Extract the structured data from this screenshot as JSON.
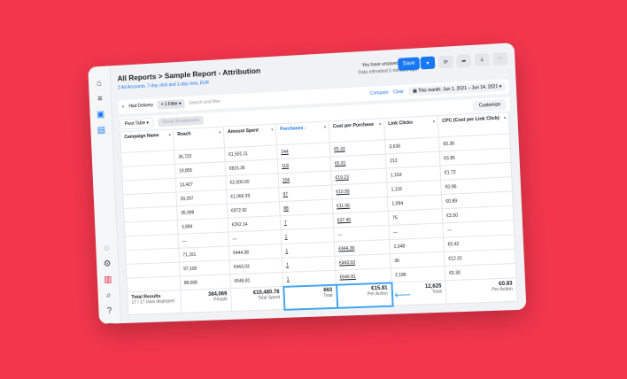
{
  "breadcrumb": {
    "root": "All Reports",
    "sep": ">",
    "current": "Sample Report - Attribution"
  },
  "subtitle": "2 Ad Accounts, 7-day click and 1-day view, EUR",
  "status": {
    "unsaved": "You have unsaved changes",
    "refreshed": "Data refreshed 5 minutes ago"
  },
  "toolbar": {
    "save": "Save",
    "save_dropdown": "▾",
    "refresh": "⟳",
    "share": "➦",
    "download": "⤓",
    "more": "···"
  },
  "filter": {
    "search_icon": "⌕",
    "delivery": "Had Delivery",
    "filter_chip": "+ 1 Filter ▾",
    "placeholder": "Search and filter",
    "compare": "Compare",
    "clear": "Clear",
    "date_icon": "▦",
    "date": "This month: Jun 1, 2021 – Jun 14, 2021 ▾"
  },
  "view": {
    "pivot": "Pivot Table ▾",
    "group": "Group Breakdowns",
    "customize": "Customize"
  },
  "sidebar": {
    "icons": [
      "⌂",
      "≡",
      "▣",
      "▤",
      "◌",
      "⚙",
      "▥",
      "⌕",
      "?",
      "▦"
    ]
  },
  "columns": [
    "Campaign Name",
    "Reach",
    "Amount Spent",
    "Purchases ↓",
    "Cost per Purchase",
    "Link Clicks",
    "CPC (Cost per Link Click)"
  ],
  "rows": [
    [
      "",
      "36,722",
      "€1,501.11",
      "244",
      "€5.33",
      "3,636",
      "€0.36"
    ],
    [
      "",
      "19,855",
      "€815.35",
      "118",
      "€6.91",
      "212",
      "€3.85"
    ],
    [
      "",
      "13,427",
      "€2,000.00",
      "104",
      "€19.23",
      "1,163",
      "€1.72"
    ],
    [
      "",
      "29,297",
      "€1,066.39",
      "97",
      "€10.99",
      "1,116",
      "€0.96"
    ],
    [
      "",
      "35,998",
      "€972.92",
      "88",
      "€11.06",
      "1,094",
      "€0.89"
    ],
    [
      "",
      "3,984",
      "€262.14",
      "7",
      "€37.45",
      "75",
      "€3.50"
    ],
    [
      "",
      "—",
      "—",
      "1",
      "—",
      "—",
      "—"
    ],
    [
      "",
      "71,151",
      "€444.38",
      "1",
      "€444.38",
      "1,048",
      "€0.42"
    ],
    [
      "",
      "97,158",
      "€443.03",
      "1",
      "€443.03",
      "36",
      "€12.31"
    ],
    [
      "",
      "88,668",
      "€646.81",
      "1",
      "€646.81",
      "2,186",
      "€0.30"
    ]
  ],
  "totals": {
    "label": "Total Results",
    "rows_displayed": "17 / 17 rows displayed",
    "reach": "384,069",
    "reach_sub": "People",
    "spent": "€10,480.78",
    "spent_sub": "Total Spent",
    "purchases": "663",
    "purchases_sub": "Total",
    "cpp": "€15.81",
    "cpp_sub": "Per Action",
    "arrow": "⟵",
    "clicks": "12,625",
    "clicks_sub": "Total",
    "cpc": "€0.83",
    "cpc_sub": "Per Action"
  },
  "colors": {
    "background": "#f4364c",
    "accent": "#1877f2",
    "highlight": "#45a6f0"
  }
}
